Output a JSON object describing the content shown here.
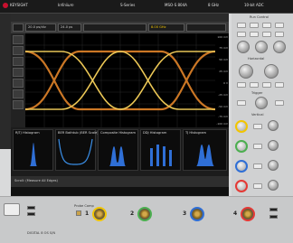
{
  "header": {
    "brand": "KEYSIGHT",
    "product_line": "Infiniium",
    "series": "S-Series",
    "model": "MSO-S 804A",
    "bandwidth": "8 GHz",
    "adc": "10-bit ADC"
  },
  "menu": [
    "File",
    "Control",
    "Setup",
    "Display",
    "Trigger",
    "Measure",
    "Math",
    "Analyze",
    "Utilities",
    "Demos",
    "Help"
  ],
  "toolbar": {
    "hscale": "20.0 ps/div",
    "hdelay": "24.0 ps",
    "bw": "8.00 GHz"
  },
  "yscale": [
    "100 mV",
    "75 mV",
    "50 mV",
    "25 mV",
    "0 V",
    "-25 mV",
    "-50 mV",
    "-75 mV",
    "-100 mV"
  ],
  "panels": [
    "RJTJ Histogram",
    "BER Bathtub (BER Scale)",
    "Composite Histogram",
    "DDJ Histogram",
    "TJ Histogram"
  ],
  "status": {
    "left": "Scroll: (Measure All Edges)"
  },
  "right_panel": {
    "title": "Run Control",
    "labels": [
      "Horizontal",
      "Trigger",
      "Vertical"
    ]
  },
  "channels": [
    "1",
    "2",
    "3",
    "4"
  ],
  "front": {
    "model_label": "DIGITAL 8 OS S/N",
    "probe_comp": "Probe Comp"
  },
  "colors": {
    "ch1": "#f2c500",
    "ch2": "#4caf50",
    "ch3": "#2f6fd6",
    "ch4": "#e53935",
    "brand": "#c8102e"
  }
}
